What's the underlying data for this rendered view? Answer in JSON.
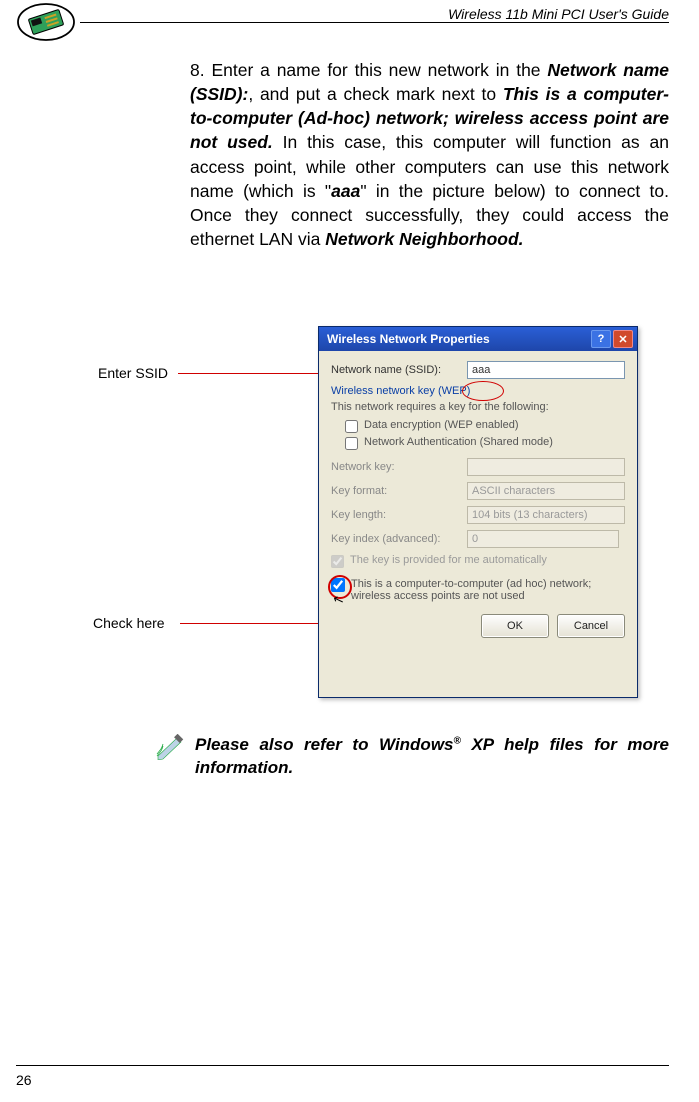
{
  "header": {
    "title": "Wireless 11b Mini PCI  User's Guide"
  },
  "body": {
    "step_prefix": "8. Enter a name for this new network in the ",
    "b1": "Network name (SSID):",
    "t2": ",  and put a check mark next to ",
    "b2": "This is a computer-to-computer (Ad-hoc) network; wireless access point are not used.",
    "t3": " In this case, this computer will function as an access point, while other computers can use this network name (which is \"",
    "b3": "aaa",
    "t4": "\" in the picture below) to connect to. Once they connect successfully, they could access the ethernet LAN via ",
    "b4": "Network Neighborhood."
  },
  "annotations": {
    "enter_ssid": "Enter SSID",
    "check_here": "Check  here"
  },
  "dialog": {
    "title": "Wireless Network Properties",
    "help_glyph": "?",
    "close_glyph": "✕",
    "ssid_label": "Network name (SSID):",
    "ssid_value": "aaa",
    "wep_section": "Wireless network key (WEP)",
    "wep_subtext": "This network requires a key for the following:",
    "chk_encrypt": "Data encryption (WEP enabled)",
    "chk_auth": "Network Authentication (Shared mode)",
    "key_label": "Network key:",
    "key_value": "",
    "fmt_label": "Key format:",
    "fmt_value": "ASCII characters",
    "len_label": "Key length:",
    "len_value": "104 bits (13 characters)",
    "idx_label": "Key index (advanced):",
    "idx_value": "0",
    "auto_key": "The key is provided for me automatically",
    "adhoc": "This is a computer-to-computer (ad hoc) network; wireless access points are not used",
    "ok": "OK",
    "cancel": "Cancel"
  },
  "note": {
    "pre": "Please also refer to Windows",
    "reg": "®",
    "post": " XP help files for more information."
  },
  "footer": {
    "page_num": "26"
  }
}
